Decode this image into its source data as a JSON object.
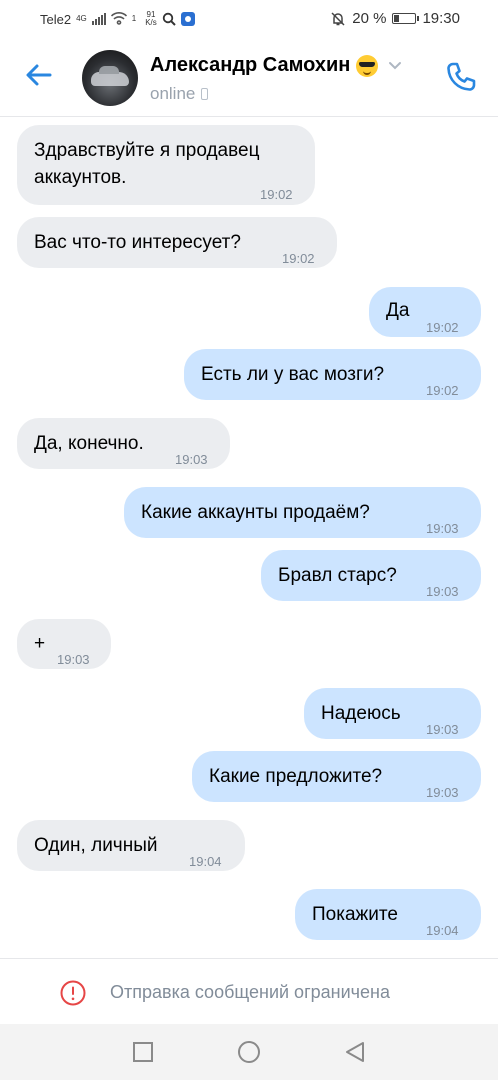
{
  "status_bar": {
    "carrier": "Tele2",
    "network": "4G",
    "speed_value": "91",
    "speed_unit": "K/s",
    "wifi_sub": "1",
    "battery": "20 %",
    "time": "19:30"
  },
  "header": {
    "name": "Александр Самохин",
    "status": "online"
  },
  "messages": [
    {
      "dir": "in",
      "text": "Здравствуйте я продавец\nаккаунтов.",
      "time": "19:02"
    },
    {
      "dir": "in",
      "text": "Вас что-то интересует?",
      "time": "19:02"
    },
    {
      "dir": "out",
      "text": "Да",
      "time": "19:02"
    },
    {
      "dir": "out",
      "text": "Есть ли у вас мозги?",
      "time": "19:02"
    },
    {
      "dir": "in",
      "text": "Да, конечно.",
      "time": "19:03"
    },
    {
      "dir": "out",
      "text": "Какие аккаунты продаём?",
      "time": "19:03"
    },
    {
      "dir": "out",
      "text": "Бравл старс?",
      "time": "19:03"
    },
    {
      "dir": "in",
      "text": "+",
      "time": "19:03"
    },
    {
      "dir": "out",
      "text": "Надеюсь",
      "time": "19:03"
    },
    {
      "dir": "out",
      "text": "Какие предложите?",
      "time": "19:03"
    },
    {
      "dir": "in",
      "text": "Один, личный",
      "time": "19:04"
    },
    {
      "dir": "out",
      "text": "Покажите",
      "time": "19:04"
    }
  ],
  "footer": {
    "restriction_text": "Отправка сообщений ограничена"
  },
  "colors": {
    "accent": "#2a87e0",
    "incoming_bubble": "#ebedf0",
    "outgoing_bubble": "#cce4ff",
    "restriction_icon": "#e64646"
  }
}
